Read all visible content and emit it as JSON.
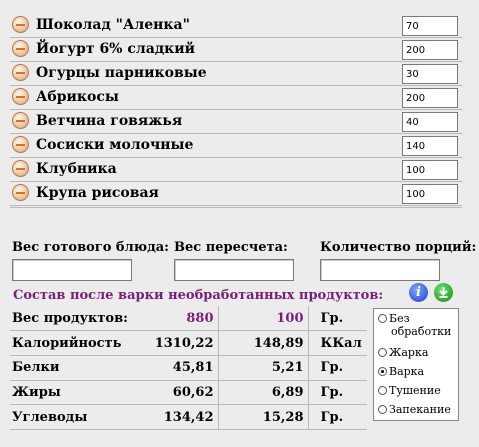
{
  "ingredients": [
    {
      "name": "Шоколад \"Аленка\"",
      "amount": "70"
    },
    {
      "name": "Йогурт 6% сладкий",
      "amount": "200"
    },
    {
      "name": "Огурцы парниковые",
      "amount": "30"
    },
    {
      "name": "Абрикосы",
      "amount": "200"
    },
    {
      "name": "Ветчина говяжья",
      "amount": "40"
    },
    {
      "name": "Сосиски молочные",
      "amount": "140"
    },
    {
      "name": "Клубника",
      "amount": "100"
    },
    {
      "name": "Крупа рисовая",
      "amount": "100"
    }
  ],
  "weights": {
    "ready_label": "Вес готового блюда:",
    "ready_value": "",
    "recalc_label": "Вес пересчета:",
    "recalc_value": "",
    "portions_label": "Количество порций:",
    "portions_value": ""
  },
  "composition_title": "Состав после варки необработанных продуктов:",
  "icons": {
    "info": "info-icon",
    "download": "download-icon"
  },
  "nutrition": {
    "rows": [
      {
        "label": "Вес продуктов:",
        "total": "880",
        "per": "100",
        "unit": "Гр."
      },
      {
        "label": "Калорийность",
        "total": "1310,22",
        "per": "148,89",
        "unit": "ККал"
      },
      {
        "label": "Белки",
        "total": "45,81",
        "per": "5,21",
        "unit": "Гр."
      },
      {
        "label": "Жиры",
        "total": "60,62",
        "per": "6,89",
        "unit": "Гр."
      },
      {
        "label": "Углеводы",
        "total": "134,42",
        "per": "15,28",
        "unit": "Гр."
      }
    ]
  },
  "cooking_methods": {
    "selected": "Варка",
    "options": [
      "Без обработки",
      "Жарка",
      "Варка",
      "Тушение",
      "Запекание"
    ],
    "option_lines": [
      [
        "Без",
        "обработки"
      ],
      [
        "Жарка"
      ],
      [
        "Варка"
      ],
      [
        "Тушение"
      ],
      [
        "Запекание"
      ]
    ]
  },
  "colors": {
    "accent_purple": "#7a1e7a",
    "info_blue": "#1a3fc7",
    "download_green": "#0e8a0e"
  }
}
